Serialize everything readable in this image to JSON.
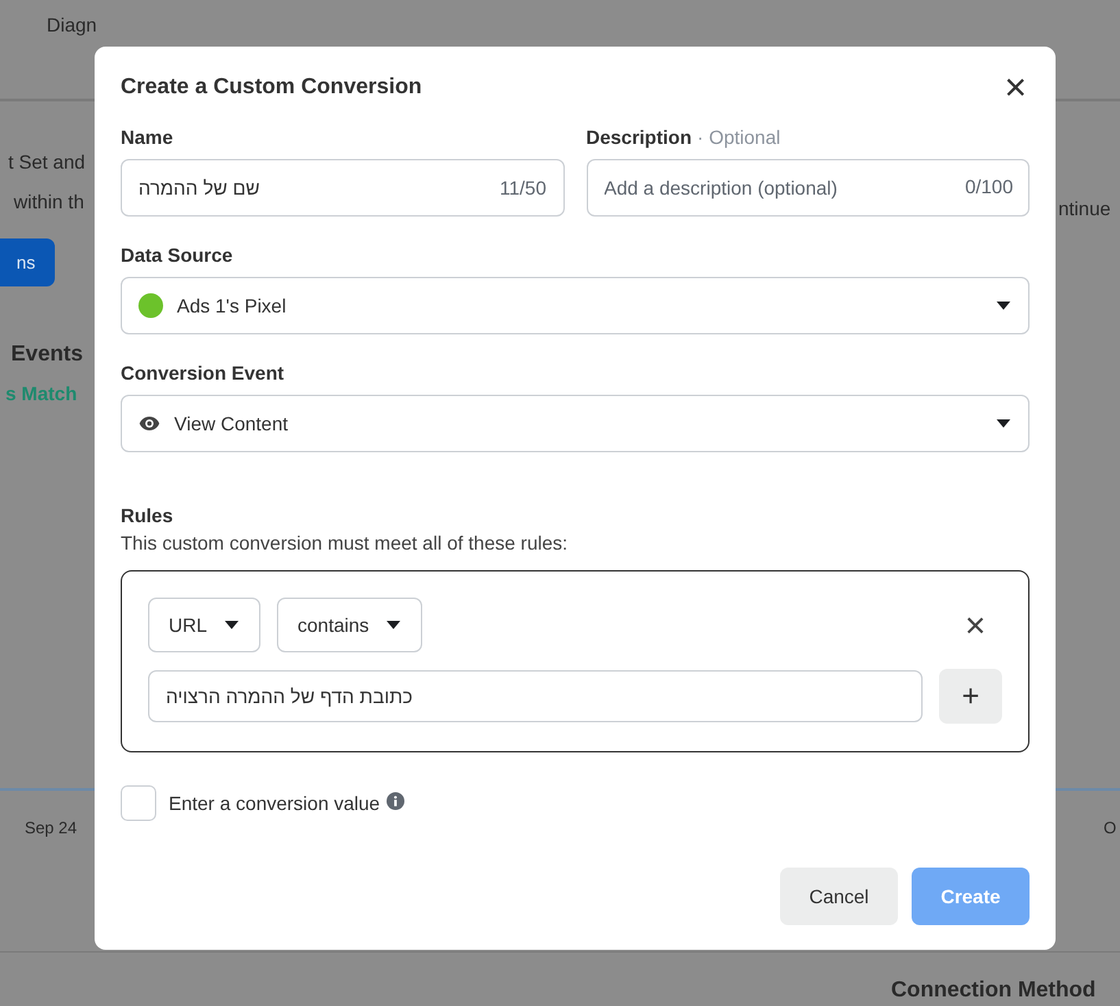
{
  "background": {
    "texts": [
      {
        "kind": "tab",
        "text": "Diagn"
      },
      {
        "kind": "line",
        "text": "t Set and"
      },
      {
        "kind": "line",
        "text": "within th"
      },
      {
        "kind": "button",
        "text": "ns"
      },
      {
        "kind": "heading",
        "text": "Events"
      },
      {
        "kind": "link",
        "text": "s Match"
      },
      {
        "kind": "line",
        "text": "ntinue"
      },
      {
        "kind": "axis",
        "text": "Sep 24"
      },
      {
        "kind": "axis",
        "text": "O"
      },
      {
        "kind": "heading",
        "text": "Connection Method"
      }
    ]
  },
  "dialog": {
    "title": "Create a Custom Conversion",
    "close": "×",
    "name": {
      "label": "Name",
      "value": "שם של ההמרה",
      "counter": "11/50"
    },
    "description": {
      "label": "Description",
      "hint": "· Optional",
      "placeholder": "Add a description (optional)",
      "counter": "0/100"
    },
    "data_source": {
      "label": "Data Source",
      "value": "Ads 1's Pixel",
      "color": "#6cc22b"
    },
    "conversion_event": {
      "label": "Conversion Event",
      "value": "View Content"
    },
    "rules": {
      "title": "Rules",
      "subtitle": "This custom conversion must meet all of these rules:",
      "items": [
        {
          "field": "URL",
          "operator": "contains",
          "value": "כתובת הדף של ההמרה הרצויה",
          "add": "+",
          "remove": "×"
        }
      ]
    },
    "conversion_value": {
      "label": "Enter a conversion value",
      "checked": false
    },
    "buttons": [
      {
        "label": "Cancel",
        "kind": "secondary",
        "disabled": false
      },
      {
        "label": "Create",
        "kind": "primary",
        "disabled": true
      }
    ]
  }
}
